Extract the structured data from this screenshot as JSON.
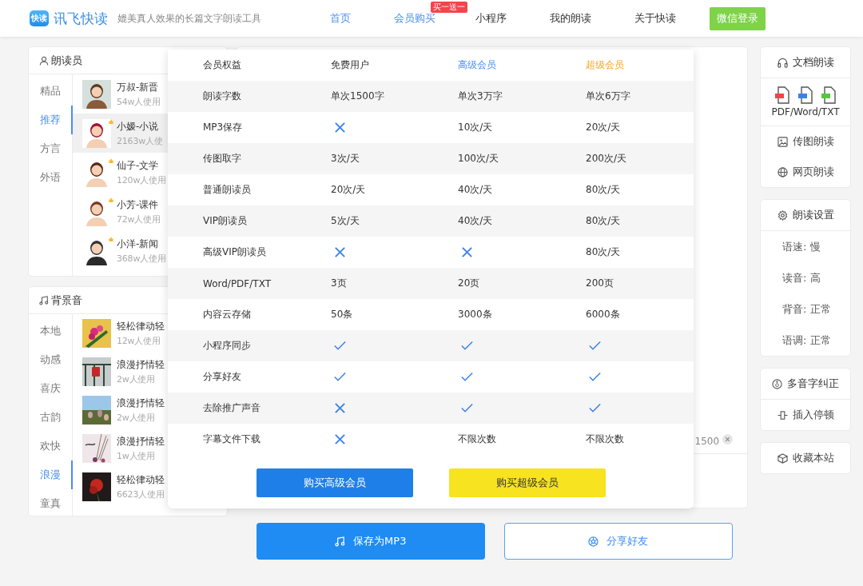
{
  "header": {
    "logo_text": "快读",
    "brand": "讯飞快读",
    "tagline": "媲美真人效果的长篇文字朗读工具",
    "nav": [
      {
        "label": "首页",
        "selected": true
      },
      {
        "label": "会员购买",
        "selected": true,
        "badge": "买一送一"
      },
      {
        "label": "小程序",
        "selected": false
      },
      {
        "label": "我的朗读",
        "selected": false
      },
      {
        "label": "关于快读",
        "selected": false
      }
    ],
    "login_button": "微信登录"
  },
  "voices": {
    "title": "朗读员",
    "categories": [
      {
        "label": "精品",
        "selected": false
      },
      {
        "label": "推荐",
        "selected": true
      },
      {
        "label": "方言",
        "selected": false
      },
      {
        "label": "外语",
        "selected": false
      }
    ],
    "items": [
      {
        "name": "万叔-新晋",
        "usage": "54w人使用",
        "vip": false,
        "selected": false
      },
      {
        "name": "小嫒-小说",
        "usage": "2163w人使",
        "vip": true,
        "selected": true
      },
      {
        "name": "仙子-文学",
        "usage": "120w人使用",
        "vip": true,
        "selected": false
      },
      {
        "name": "小芳-课件",
        "usage": "72w人使用",
        "vip": true,
        "selected": false
      },
      {
        "name": "小洋-新闻",
        "usage": "368w人使用",
        "vip": true,
        "selected": false
      }
    ]
  },
  "music": {
    "title": "背景音",
    "categories": [
      {
        "label": "本地",
        "selected": false
      },
      {
        "label": "动感",
        "selected": false
      },
      {
        "label": "喜庆",
        "selected": false
      },
      {
        "label": "古韵",
        "selected": false
      },
      {
        "label": "欢快",
        "selected": false
      },
      {
        "label": "浪漫",
        "selected": true
      },
      {
        "label": "童真",
        "selected": false
      }
    ],
    "items": [
      {
        "name": "轻松律动轻",
        "usage": "12w人使用"
      },
      {
        "name": "浪漫抒情轻",
        "usage": "2w人使用"
      },
      {
        "name": "浪漫抒情轻",
        "usage": "2w人使用"
      },
      {
        "name": "浪漫抒情轻",
        "usage": "1w人使用"
      },
      {
        "name": "轻松律动轻",
        "usage": "6623人使用"
      }
    ]
  },
  "editor": {
    "char_count": "1500"
  },
  "actions": [
    {
      "label": "保存为MP3",
      "kind": "primary"
    },
    {
      "label": "分享好友",
      "kind": "outline"
    }
  ],
  "tools": [
    {
      "items": [
        {
          "label": "文档朗读",
          "kind": "header"
        },
        {
          "label": "PDF/Word/TXT",
          "kind": "files"
        },
        {
          "label": "传图朗读",
          "kind": "link"
        },
        {
          "label": "网页朗读",
          "kind": "link"
        }
      ]
    },
    {
      "items": [
        {
          "label": "朗读设置",
          "kind": "header"
        },
        {
          "label": "语速: 慢",
          "kind": "setting"
        },
        {
          "label": "读音: 高",
          "kind": "setting"
        },
        {
          "label": "背音: 正常",
          "kind": "setting"
        },
        {
          "label": "语调: 正常",
          "kind": "setting"
        }
      ]
    },
    {
      "items": [
        {
          "label": "多音字纠正",
          "kind": "header"
        },
        {
          "label": "插入停顿",
          "kind": "link"
        }
      ]
    },
    {
      "items": [
        {
          "label": "收藏本站",
          "kind": "link"
        }
      ]
    }
  ],
  "membership": {
    "columns": [
      {
        "label": "会员权益",
        "kind": "plain"
      },
      {
        "label": "免费用户",
        "kind": "plain"
      },
      {
        "label": "高级会员",
        "kind": "premium"
      },
      {
        "label": "超级会员",
        "kind": "super"
      }
    ],
    "rows": [
      {
        "cells": [
          {
            "kind": "text",
            "text": "朗读字数"
          },
          {
            "kind": "text",
            "text": "单次1500字"
          },
          {
            "kind": "text",
            "text": "单次3万字"
          },
          {
            "kind": "text",
            "text": "单次6万字"
          }
        ]
      },
      {
        "cells": [
          {
            "kind": "text",
            "text": "MP3保存"
          },
          {
            "kind": "cross"
          },
          {
            "kind": "text",
            "text": "10次/天"
          },
          {
            "kind": "text",
            "text": "20次/天"
          }
        ]
      },
      {
        "cells": [
          {
            "kind": "text",
            "text": "传图取字"
          },
          {
            "kind": "text",
            "text": "3次/天"
          },
          {
            "kind": "text",
            "text": "100次/天"
          },
          {
            "kind": "text",
            "text": "200次/天"
          }
        ]
      },
      {
        "cells": [
          {
            "kind": "text",
            "text": "普通朗读员"
          },
          {
            "kind": "text",
            "text": "20次/天"
          },
          {
            "kind": "text",
            "text": "40次/天"
          },
          {
            "kind": "text",
            "text": "80次/天"
          }
        ]
      },
      {
        "cells": [
          {
            "kind": "text",
            "text": "VIP朗读员"
          },
          {
            "kind": "text",
            "text": "5次/天"
          },
          {
            "kind": "text",
            "text": "40次/天"
          },
          {
            "kind": "text",
            "text": "80次/天"
          }
        ]
      },
      {
        "cells": [
          {
            "kind": "text",
            "text": "高级VIP朗读员"
          },
          {
            "kind": "cross"
          },
          {
            "kind": "cross"
          },
          {
            "kind": "text",
            "text": "80次/天"
          }
        ]
      },
      {
        "cells": [
          {
            "kind": "text",
            "text": "Word/PDF/TXT"
          },
          {
            "kind": "text",
            "text": "3页"
          },
          {
            "kind": "text",
            "text": "20页"
          },
          {
            "kind": "text",
            "text": "200页"
          }
        ]
      },
      {
        "cells": [
          {
            "kind": "text",
            "text": "内容云存储"
          },
          {
            "kind": "text",
            "text": "50条"
          },
          {
            "kind": "text",
            "text": "3000条"
          },
          {
            "kind": "text",
            "text": "6000条"
          }
        ]
      },
      {
        "cells": [
          {
            "kind": "text",
            "text": "小程序同步"
          },
          {
            "kind": "check"
          },
          {
            "kind": "check"
          },
          {
            "kind": "check"
          }
        ]
      },
      {
        "cells": [
          {
            "kind": "text",
            "text": "分享好友"
          },
          {
            "kind": "check"
          },
          {
            "kind": "check"
          },
          {
            "kind": "check"
          }
        ]
      },
      {
        "cells": [
          {
            "kind": "text",
            "text": "去除推广声音"
          },
          {
            "kind": "cross"
          },
          {
            "kind": "check"
          },
          {
            "kind": "check"
          }
        ]
      },
      {
        "cells": [
          {
            "kind": "text",
            "text": "字幕文件下载"
          },
          {
            "kind": "cross"
          },
          {
            "kind": "text",
            "text": "不限次数"
          },
          {
            "kind": "text",
            "text": "不限次数"
          }
        ]
      }
    ],
    "buttons": [
      {
        "label": "购买高级会员",
        "kind": "premium"
      },
      {
        "label": "购买超级会员",
        "kind": "super"
      }
    ]
  }
}
